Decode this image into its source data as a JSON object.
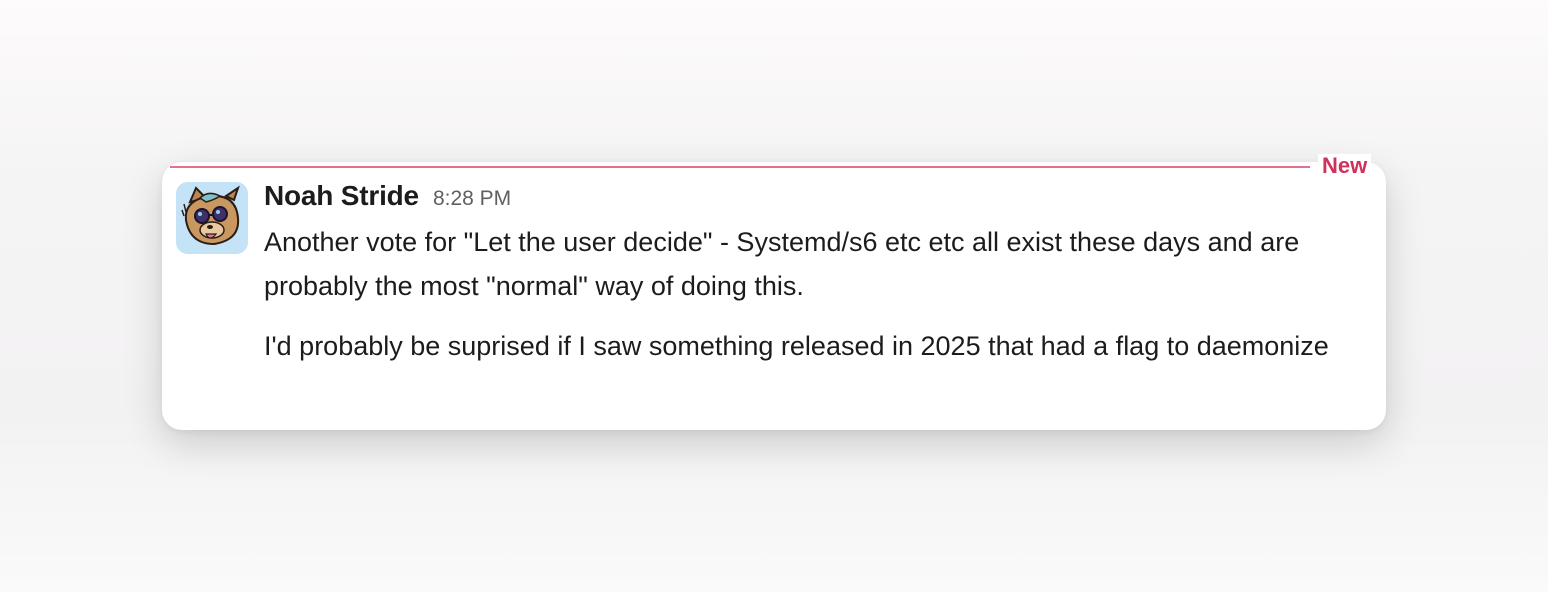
{
  "divider": {
    "new_label": "New",
    "color": "#e0577a"
  },
  "message": {
    "author": "Noah Stride",
    "timestamp": "8:28 PM",
    "avatar_icon": "cartoon-animal-avatar-icon",
    "paragraphs": [
      "Another vote for \"Let the user decide\" - Systemd/s6 etc etc all exist these days and are probably the most \"normal\" way of doing this.",
      "I'd probably be suprised if I saw something released in 2025 that had a flag to daemonize"
    ]
  }
}
